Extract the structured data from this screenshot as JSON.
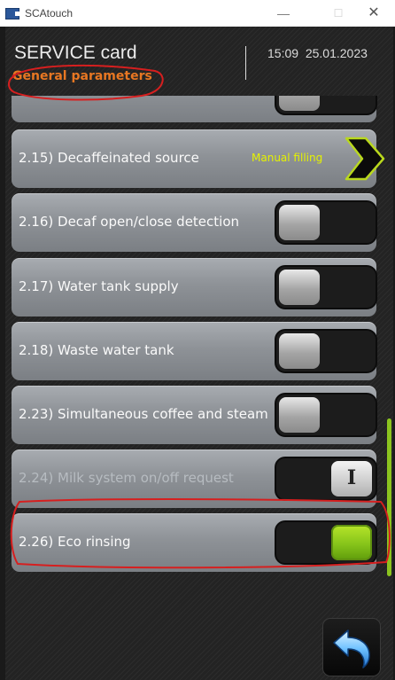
{
  "window": {
    "title": "SCAtouch",
    "minimize_glyph": "—",
    "maximize_glyph": "☐",
    "close_glyph": "✕"
  },
  "header": {
    "title": "SERVICE card",
    "subtitle": "General parameters",
    "time": "15:09",
    "date": "25.01.2023"
  },
  "rows": [
    {
      "label": "",
      "control": "toggle",
      "state": "off"
    },
    {
      "label": "2.15) Decaffeinated source",
      "value": "Manual filling",
      "control": "chevron"
    },
    {
      "label": "2.16) Decaf open/close detection",
      "control": "toggle",
      "state": "off"
    },
    {
      "label": "2.17) Water tank supply",
      "control": "toggle",
      "state": "off"
    },
    {
      "label": "2.18) Waste water tank",
      "control": "toggle",
      "state": "off"
    },
    {
      "label": "2.23) Simultaneous coffee and steam",
      "control": "toggle",
      "state": "off"
    },
    {
      "label": "2.24) Milk system on/off request",
      "control": "toggle",
      "state": "neutral",
      "knob_glyph": "I",
      "disabled": true
    },
    {
      "label": "2.26) Eco rinsing",
      "control": "toggle",
      "state": "on"
    }
  ],
  "footer": {
    "back_icon": "back-arrow-icon"
  },
  "colors": {
    "accent_orange": "#e87722",
    "toggle_on": "#86c41a",
    "value_yellow": "#e5f200",
    "annotation_red": "#d61f1f"
  }
}
